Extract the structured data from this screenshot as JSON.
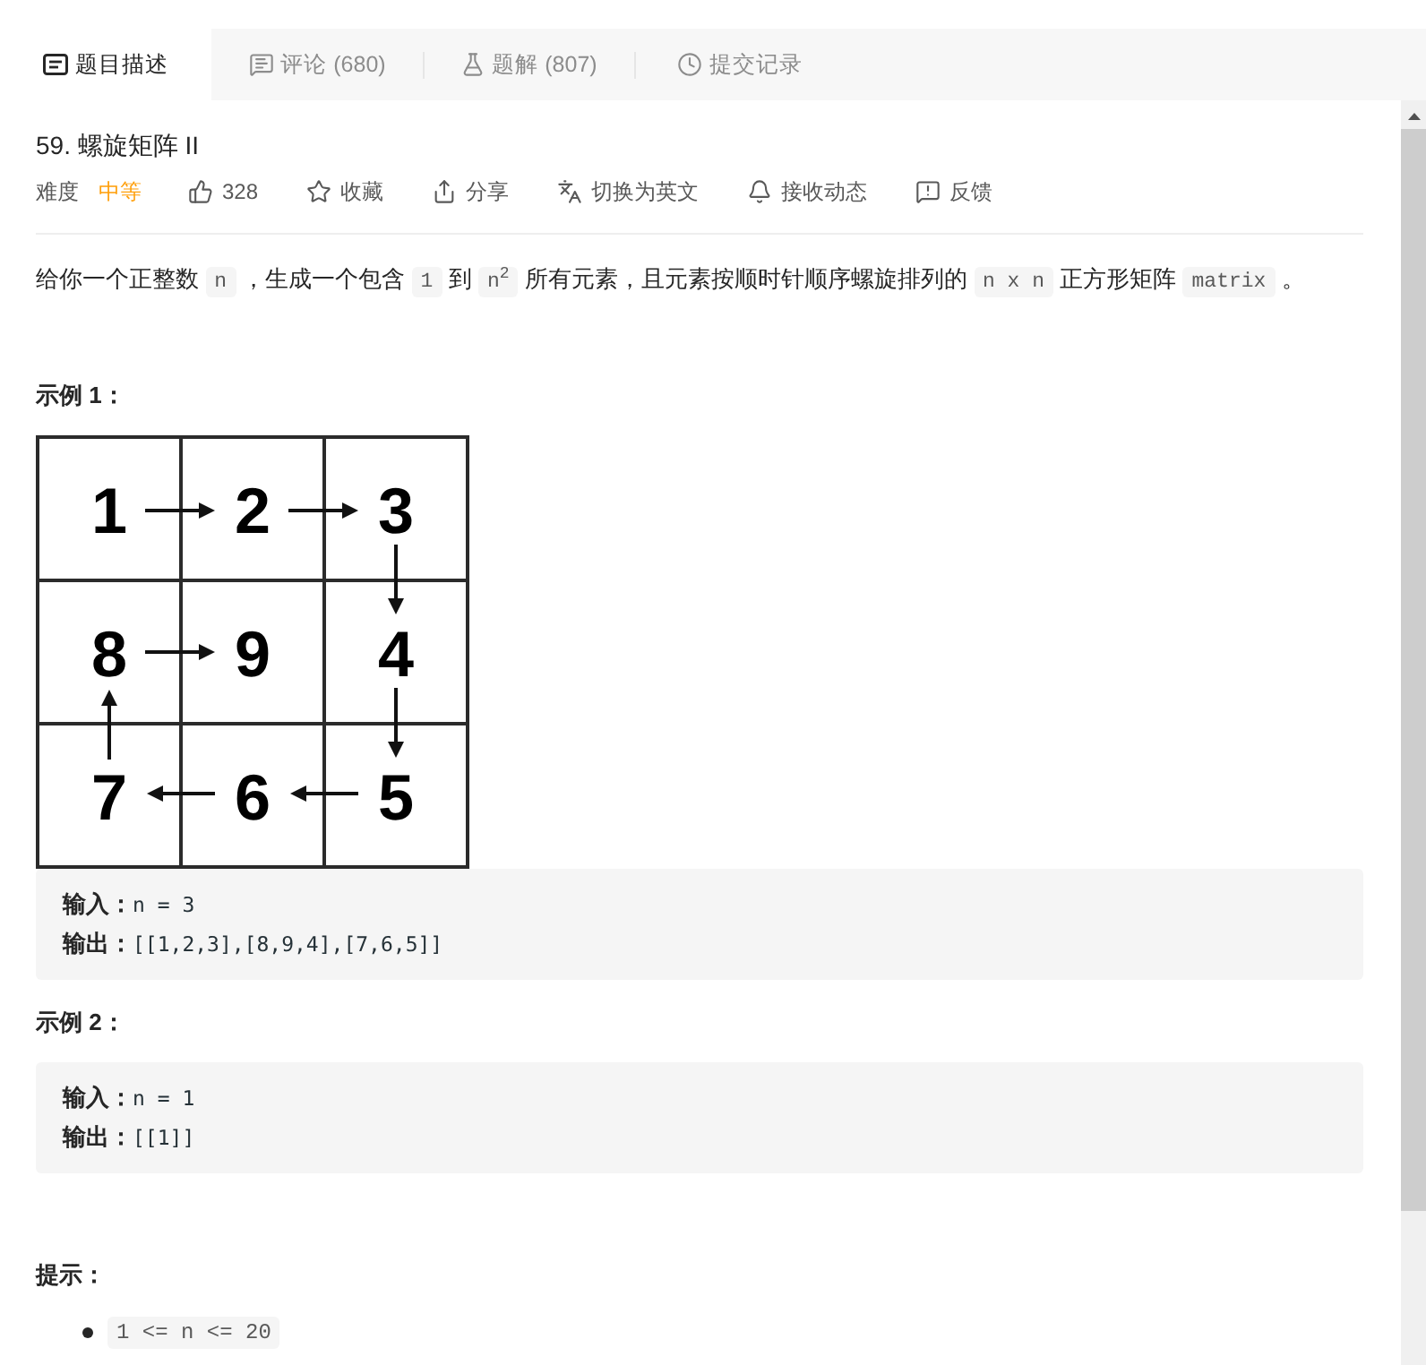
{
  "tabs": [
    {
      "label": "题目描述",
      "selected": true
    },
    {
      "label": "评论 (680)",
      "selected": false
    },
    {
      "label": "题解 (807)",
      "selected": false
    },
    {
      "label": "提交记录",
      "selected": false
    }
  ],
  "problem": {
    "title": "59. 螺旋矩阵 II",
    "difficulty_label": "难度",
    "difficulty": "中等",
    "actions": [
      {
        "label": "328"
      },
      {
        "label": "收藏"
      },
      {
        "label": "分享"
      },
      {
        "label": "切换为英文"
      },
      {
        "label": "接收动态"
      },
      {
        "label": "反馈"
      }
    ]
  },
  "description": [
    {
      "kind": "text",
      "text": "给你一个正整数"
    },
    {
      "kind": "code",
      "text": "n"
    },
    {
      "kind": "text",
      "text": "，生成一个包含"
    },
    {
      "kind": "code",
      "text": "1"
    },
    {
      "kind": "text",
      "text": "到"
    },
    {
      "kind": "code",
      "text": "n$^{2}$"
    },
    {
      "kind": "text",
      "text": "所有元素，且元素按顺时针顺序螺旋排列的"
    },
    {
      "kind": "code",
      "text": "n x n"
    },
    {
      "kind": "text",
      "text": "正方形矩阵"
    },
    {
      "kind": "code",
      "text": "matrix"
    },
    {
      "kind": "text",
      "text": "。"
    }
  ],
  "examples": [
    {
      "heading": "示例 1：",
      "matrix": [
        "1",
        "2",
        "3",
        "8",
        "9",
        "4",
        "7",
        "6",
        "5"
      ],
      "lines": [
        {
          "label": "输入：",
          "value": "n = 3"
        },
        {
          "label": "输出：",
          "value": "[[1,2,3],[8,9,4],[7,6,5]]"
        }
      ]
    },
    {
      "heading": "示例 2：",
      "lines": [
        {
          "label": "输入：",
          "value": "n = 1"
        },
        {
          "label": "输出：",
          "value": "[[1]]"
        }
      ]
    }
  ],
  "hints": {
    "heading": "提示：",
    "items": [
      "1 <= n <= 20"
    ]
  }
}
